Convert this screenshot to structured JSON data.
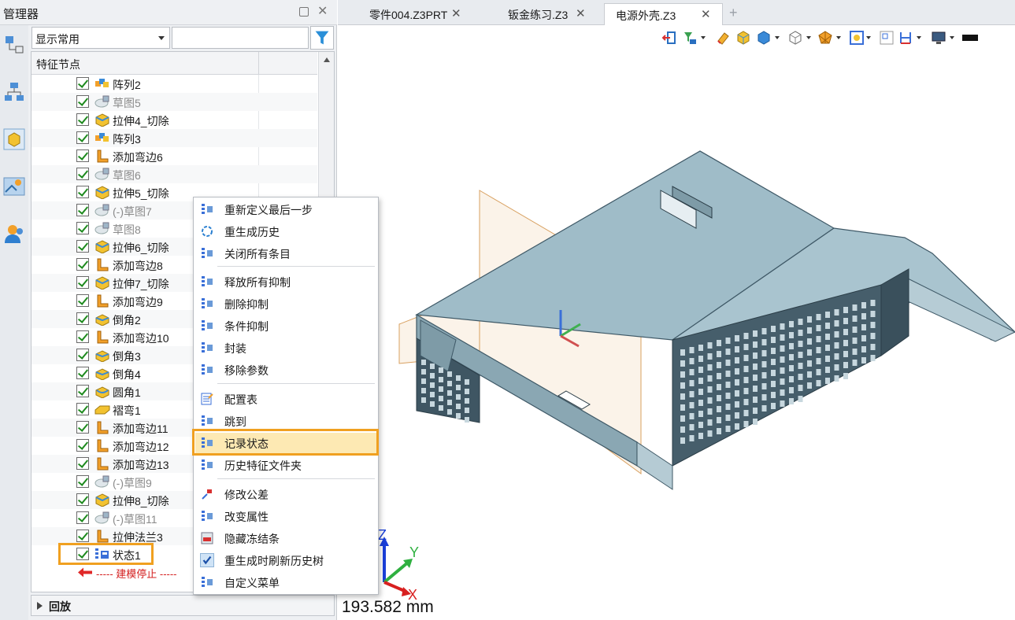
{
  "panel": {
    "title": "管理器",
    "filter_value": "显示常用",
    "search_value": "",
    "tree_header": "特征节点",
    "items": [
      {
        "label": "阵列2",
        "icon": "pattern-icon",
        "dim": false
      },
      {
        "label": "草图5",
        "icon": "sketch-icon",
        "dim": true
      },
      {
        "label": "拉伸4_切除",
        "icon": "extrude-cut-icon",
        "dim": false
      },
      {
        "label": "阵列3",
        "icon": "pattern-icon",
        "dim": false
      },
      {
        "label": "添加弯边6",
        "icon": "flange-icon",
        "dim": false
      },
      {
        "label": "草图6",
        "icon": "sketch-icon",
        "dim": true
      },
      {
        "label": "拉伸5_切除",
        "icon": "extrude-cut-icon",
        "dim": false
      },
      {
        "label": "(-)草图7",
        "icon": "sketch-icon",
        "dim": true
      },
      {
        "label": "草图8",
        "icon": "sketch-icon",
        "dim": true
      },
      {
        "label": "拉伸6_切除",
        "icon": "extrude-cut-icon",
        "dim": false
      },
      {
        "label": "添加弯边8",
        "icon": "flange-icon",
        "dim": false
      },
      {
        "label": "拉伸7_切除",
        "icon": "extrude-cut-icon",
        "dim": false
      },
      {
        "label": "添加弯边9",
        "icon": "flange-icon",
        "dim": false
      },
      {
        "label": "倒角2",
        "icon": "chamfer-icon",
        "dim": false
      },
      {
        "label": "添加弯边10",
        "icon": "flange-icon",
        "dim": false
      },
      {
        "label": "倒角3",
        "icon": "chamfer-icon",
        "dim": false
      },
      {
        "label": "倒角4",
        "icon": "chamfer-icon",
        "dim": false
      },
      {
        "label": "圆角1",
        "icon": "fillet-icon",
        "dim": false
      },
      {
        "label": "褶弯1",
        "icon": "jog-icon",
        "dim": false
      },
      {
        "label": "添加弯边11",
        "icon": "flange-icon",
        "dim": false
      },
      {
        "label": "添加弯边12",
        "icon": "flange-icon",
        "dim": false
      },
      {
        "label": "添加弯边13",
        "icon": "flange-icon",
        "dim": false
      },
      {
        "label": "(-)草图9",
        "icon": "sketch-icon",
        "dim": true
      },
      {
        "label": "拉伸8_切除",
        "icon": "extrude-cut-icon",
        "dim": false
      },
      {
        "label": "(-)草图11",
        "icon": "sketch-icon",
        "dim": true
      },
      {
        "label": "拉伸法兰3",
        "icon": "flange-icon",
        "dim": false
      },
      {
        "label": "状态1",
        "icon": "state-icon",
        "dim": false
      }
    ],
    "stop_label": "----- 建模停止 -----",
    "playback_label": "回放"
  },
  "tabs": [
    {
      "label": "零件004.Z3PRT",
      "active": false
    },
    {
      "label": "钣金练习.Z3",
      "active": false
    },
    {
      "label": "电源外壳.Z3",
      "active": true
    }
  ],
  "context_menu": {
    "groups": [
      [
        {
          "label": "重新定义最后一步",
          "icon": "redefine-icon"
        },
        {
          "label": "重生成历史",
          "icon": "regen-icon"
        },
        {
          "label": "关闭所有条目",
          "icon": "collapse-icon"
        }
      ],
      [
        {
          "label": "释放所有抑制",
          "icon": "unsuppress-all-icon"
        },
        {
          "label": "删除抑制",
          "icon": "delete-suppress-icon"
        },
        {
          "label": "条件抑制",
          "icon": "conditional-suppress-icon"
        },
        {
          "label": "封装",
          "icon": "encapsulate-icon"
        },
        {
          "label": "移除参数",
          "icon": "remove-params-icon"
        }
      ],
      [
        {
          "label": "配置表",
          "icon": "config-table-icon"
        },
        {
          "label": "跳到",
          "icon": "jump-icon"
        },
        {
          "label": "记录状态",
          "icon": "record-state-icon",
          "active": true
        },
        {
          "label": "历史特征文件夹",
          "icon": "history-folder-icon"
        }
      ],
      [
        {
          "label": "修改公差",
          "icon": "tolerance-icon"
        },
        {
          "label": "改变属性",
          "icon": "properties-icon"
        },
        {
          "label": "隐藏冻结条",
          "icon": "hide-freeze-icon"
        },
        {
          "label": "重生成时刷新历史树",
          "icon": "check-icon",
          "checked": true
        },
        {
          "label": "自定义菜单",
          "icon": "custom-menu-icon"
        }
      ]
    ]
  },
  "viewport": {
    "measurement": "193.582 mm",
    "axes": {
      "x": "X",
      "y": "Y",
      "z": "Z"
    }
  },
  "colors": {
    "accent_highlight": "#f0a020",
    "model_fill": "#9fbcc8",
    "model_dark": "#4a6472",
    "stop_red": "#d42020"
  }
}
